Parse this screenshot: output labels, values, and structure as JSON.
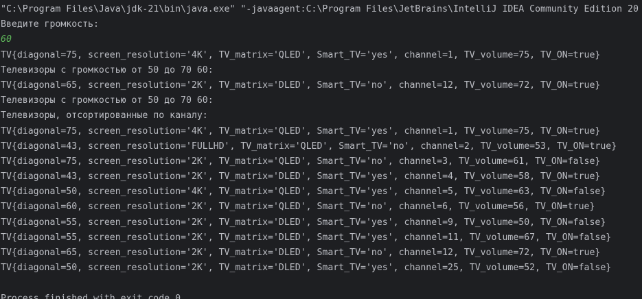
{
  "console": {
    "command": "\"C:\\Program Files\\Java\\jdk-21\\bin\\java.exe\" \"-javaagent:C:\\Program Files\\JetBrains\\IntelliJ IDEA Community Edition 20",
    "prompt": "Введите громкость:",
    "input": "60",
    "lines": [
      "TV{diagonal=75, screen_resolution='4K', TV_matrix='QLED', Smart_TV='yes', channel=1, TV_volume=75, TV_ON=true}",
      "Телевизоры с громкостью от 50 до 70 60:",
      "TV{diagonal=65, screen_resolution='2K', TV_matrix='DLED', Smart_TV='no', channel=12, TV_volume=72, TV_ON=true}",
      "Телевизоры с громкостью от 50 до 70 60:",
      "Телевизоры, отсортированные по каналу:",
      "TV{diagonal=75, screen_resolution='4K', TV_matrix='QLED', Smart_TV='yes', channel=1, TV_volume=75, TV_ON=true}",
      "TV{diagonal=43, screen_resolution='FULLHD', TV_matrix='QLED', Smart_TV='no', channel=2, TV_volume=53, TV_ON=true}",
      "TV{diagonal=75, screen_resolution='2K', TV_matrix='QLED', Smart_TV='no', channel=3, TV_volume=61, TV_ON=false}",
      "TV{diagonal=43, screen_resolution='2K', TV_matrix='DLED', Smart_TV='yes', channel=4, TV_volume=58, TV_ON=true}",
      "TV{diagonal=50, screen_resolution='4K', TV_matrix='QLED', Smart_TV='yes', channel=5, TV_volume=63, TV_ON=false}",
      "TV{diagonal=60, screen_resolution='2K', TV_matrix='QLED', Smart_TV='no', channel=6, TV_volume=56, TV_ON=true}",
      "TV{diagonal=55, screen_resolution='2K', TV_matrix='DLED', Smart_TV='yes', channel=9, TV_volume=50, TV_ON=false}",
      "TV{diagonal=55, screen_resolution='2K', TV_matrix='DLED', Smart_TV='yes', channel=11, TV_volume=67, TV_ON=false}",
      "TV{diagonal=65, screen_resolution='2K', TV_matrix='DLED', Smart_TV='no', channel=12, TV_volume=72, TV_ON=true}",
      "TV{diagonal=50, screen_resolution='2K', TV_matrix='DLED', Smart_TV='yes', channel=25, TV_volume=52, TV_ON=false}"
    ],
    "exit_message": "Process finished with exit code 0"
  },
  "colors": {
    "background": "#1e1f22",
    "text": "#bcbec4",
    "user_input": "#5fb85a"
  }
}
